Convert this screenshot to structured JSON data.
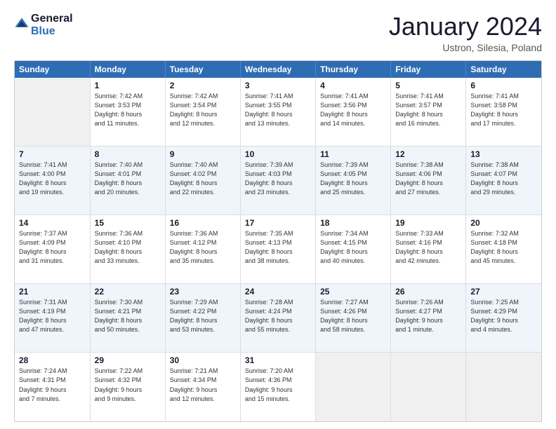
{
  "header": {
    "logo_line1": "General",
    "logo_line2": "Blue",
    "month_title": "January 2024",
    "location": "Ustron, Silesia, Poland"
  },
  "weekdays": [
    "Sunday",
    "Monday",
    "Tuesday",
    "Wednesday",
    "Thursday",
    "Friday",
    "Saturday"
  ],
  "weeks": [
    [
      {
        "day": "",
        "info": ""
      },
      {
        "day": "1",
        "info": "Sunrise: 7:42 AM\nSunset: 3:53 PM\nDaylight: 8 hours\nand 11 minutes."
      },
      {
        "day": "2",
        "info": "Sunrise: 7:42 AM\nSunset: 3:54 PM\nDaylight: 8 hours\nand 12 minutes."
      },
      {
        "day": "3",
        "info": "Sunrise: 7:41 AM\nSunset: 3:55 PM\nDaylight: 8 hours\nand 13 minutes."
      },
      {
        "day": "4",
        "info": "Sunrise: 7:41 AM\nSunset: 3:56 PM\nDaylight: 8 hours\nand 14 minutes."
      },
      {
        "day": "5",
        "info": "Sunrise: 7:41 AM\nSunset: 3:57 PM\nDaylight: 8 hours\nand 16 minutes."
      },
      {
        "day": "6",
        "info": "Sunrise: 7:41 AM\nSunset: 3:58 PM\nDaylight: 8 hours\nand 17 minutes."
      }
    ],
    [
      {
        "day": "7",
        "info": "Sunrise: 7:41 AM\nSunset: 4:00 PM\nDaylight: 8 hours\nand 19 minutes."
      },
      {
        "day": "8",
        "info": "Sunrise: 7:40 AM\nSunset: 4:01 PM\nDaylight: 8 hours\nand 20 minutes."
      },
      {
        "day": "9",
        "info": "Sunrise: 7:40 AM\nSunset: 4:02 PM\nDaylight: 8 hours\nand 22 minutes."
      },
      {
        "day": "10",
        "info": "Sunrise: 7:39 AM\nSunset: 4:03 PM\nDaylight: 8 hours\nand 23 minutes."
      },
      {
        "day": "11",
        "info": "Sunrise: 7:39 AM\nSunset: 4:05 PM\nDaylight: 8 hours\nand 25 minutes."
      },
      {
        "day": "12",
        "info": "Sunrise: 7:38 AM\nSunset: 4:06 PM\nDaylight: 8 hours\nand 27 minutes."
      },
      {
        "day": "13",
        "info": "Sunrise: 7:38 AM\nSunset: 4:07 PM\nDaylight: 8 hours\nand 29 minutes."
      }
    ],
    [
      {
        "day": "14",
        "info": "Sunrise: 7:37 AM\nSunset: 4:09 PM\nDaylight: 8 hours\nand 31 minutes."
      },
      {
        "day": "15",
        "info": "Sunrise: 7:36 AM\nSunset: 4:10 PM\nDaylight: 8 hours\nand 33 minutes."
      },
      {
        "day": "16",
        "info": "Sunrise: 7:36 AM\nSunset: 4:12 PM\nDaylight: 8 hours\nand 35 minutes."
      },
      {
        "day": "17",
        "info": "Sunrise: 7:35 AM\nSunset: 4:13 PM\nDaylight: 8 hours\nand 38 minutes."
      },
      {
        "day": "18",
        "info": "Sunrise: 7:34 AM\nSunset: 4:15 PM\nDaylight: 8 hours\nand 40 minutes."
      },
      {
        "day": "19",
        "info": "Sunrise: 7:33 AM\nSunset: 4:16 PM\nDaylight: 8 hours\nand 42 minutes."
      },
      {
        "day": "20",
        "info": "Sunrise: 7:32 AM\nSunset: 4:18 PM\nDaylight: 8 hours\nand 45 minutes."
      }
    ],
    [
      {
        "day": "21",
        "info": "Sunrise: 7:31 AM\nSunset: 4:19 PM\nDaylight: 8 hours\nand 47 minutes."
      },
      {
        "day": "22",
        "info": "Sunrise: 7:30 AM\nSunset: 4:21 PM\nDaylight: 8 hours\nand 50 minutes."
      },
      {
        "day": "23",
        "info": "Sunrise: 7:29 AM\nSunset: 4:22 PM\nDaylight: 8 hours\nand 53 minutes."
      },
      {
        "day": "24",
        "info": "Sunrise: 7:28 AM\nSunset: 4:24 PM\nDaylight: 8 hours\nand 55 minutes."
      },
      {
        "day": "25",
        "info": "Sunrise: 7:27 AM\nSunset: 4:26 PM\nDaylight: 8 hours\nand 58 minutes."
      },
      {
        "day": "26",
        "info": "Sunrise: 7:26 AM\nSunset: 4:27 PM\nDaylight: 9 hours\nand 1 minute."
      },
      {
        "day": "27",
        "info": "Sunrise: 7:25 AM\nSunset: 4:29 PM\nDaylight: 9 hours\nand 4 minutes."
      }
    ],
    [
      {
        "day": "28",
        "info": "Sunrise: 7:24 AM\nSunset: 4:31 PM\nDaylight: 9 hours\nand 7 minutes."
      },
      {
        "day": "29",
        "info": "Sunrise: 7:22 AM\nSunset: 4:32 PM\nDaylight: 9 hours\nand 9 minutes."
      },
      {
        "day": "30",
        "info": "Sunrise: 7:21 AM\nSunset: 4:34 PM\nDaylight: 9 hours\nand 12 minutes."
      },
      {
        "day": "31",
        "info": "Sunrise: 7:20 AM\nSunset: 4:36 PM\nDaylight: 9 hours\nand 15 minutes."
      },
      {
        "day": "",
        "info": ""
      },
      {
        "day": "",
        "info": ""
      },
      {
        "day": "",
        "info": ""
      }
    ]
  ]
}
